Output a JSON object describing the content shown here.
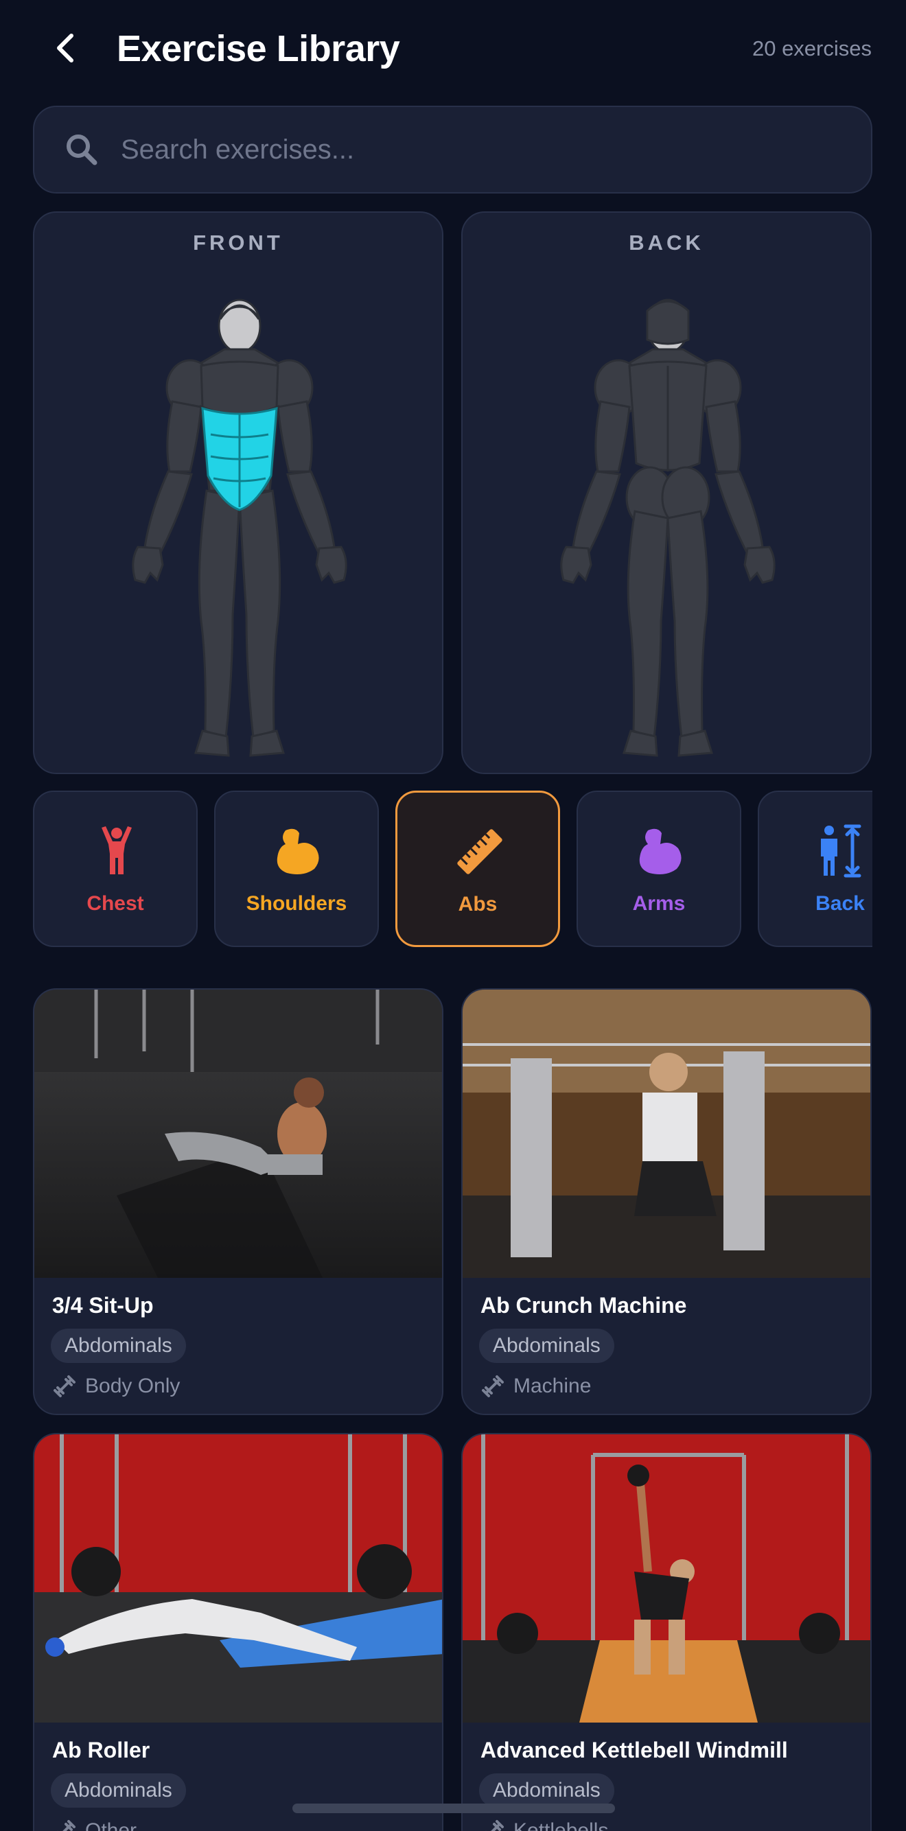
{
  "header": {
    "title": "Exercise Library",
    "count_label": "20 exercises"
  },
  "search": {
    "placeholder": "Search exercises..."
  },
  "body_maps": {
    "front_label": "FRONT",
    "back_label": "BACK",
    "highlighted_muscle": "abdominals",
    "highlight_color": "#22d3e6"
  },
  "categories": [
    {
      "label": "Chest",
      "icon": "person-arms-up-icon",
      "color": "#e5484d",
      "selected": false
    },
    {
      "label": "Shoulders",
      "icon": "flexed-bicep-icon",
      "color": "#f5a623",
      "selected": false
    },
    {
      "label": "Abs",
      "icon": "ruler-icon",
      "color": "#f29a3e",
      "selected": true
    },
    {
      "label": "Arms",
      "icon": "flexed-bicep-icon",
      "color": "#a55eea",
      "selected": false
    },
    {
      "label": "Back",
      "icon": "person-height-icon",
      "color": "#3b82f6",
      "selected": false
    }
  ],
  "exercises": [
    {
      "name": "3/4 Sit-Up",
      "muscle": "Abdominals",
      "equipment": "Body Only"
    },
    {
      "name": "Ab Crunch Machine",
      "muscle": "Abdominals",
      "equipment": "Machine"
    },
    {
      "name": "Ab Roller",
      "muscle": "Abdominals",
      "equipment": "Other"
    },
    {
      "name": "Advanced Kettlebell Windmill",
      "muscle": "Abdominals",
      "equipment": "Kettlebells"
    }
  ],
  "colors": {
    "background": "#0b1020",
    "card": "#1a2035",
    "accent": "#f29a3e",
    "muscle_base": "#3a3d45"
  }
}
